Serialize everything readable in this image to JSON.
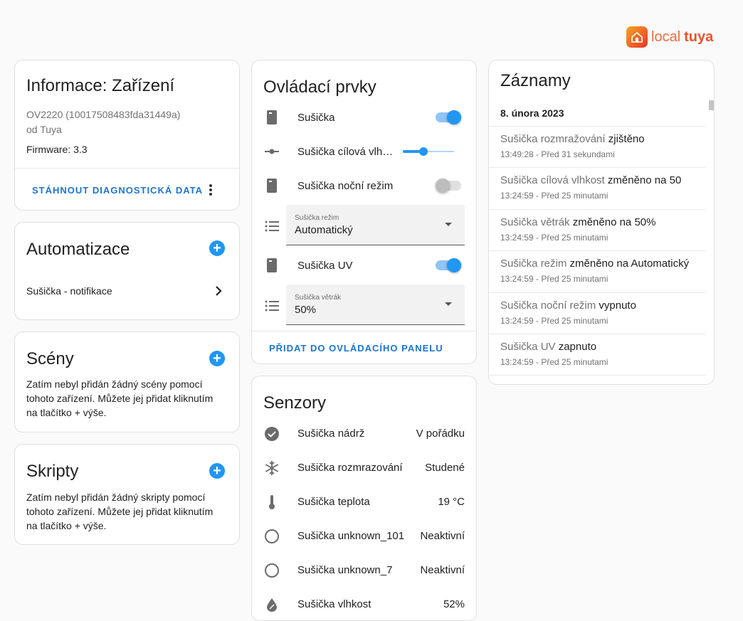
{
  "logo": {
    "word1": "local",
    "word2": "tuya",
    "color1": "#f26b3a",
    "color2": "#e8532a"
  },
  "info_card": {
    "title": "Informace: Zařízení",
    "model": "OV2220 (10017508483fda31449a)",
    "manufacturer": "od Tuya",
    "firmware": "Firmware: 3.3",
    "download_label": "STÁHNOUT DIAGNOSTICKÁ DATA"
  },
  "automation_card": {
    "title": "Automatizace",
    "item_label": "Sušička - notifikace"
  },
  "scenes_card": {
    "title": "Scény",
    "text": "Zatím nebyl přidán žádný scény pomocí tohoto zařízení. Můžete jej přidat kliknutím na tlačítko + výše."
  },
  "scripts_card": {
    "title": "Skripty",
    "text": "Zatím nebyl přidán žádný skripty pomocí tohoto zařízení. Můžete jej přidat kliknutím na tlačítko + výše."
  },
  "controls_card": {
    "title": "Ovládací prvky",
    "dryer_label": "Sušička",
    "dryer_on": true,
    "humidity_label": "Sušička cílová vlh…",
    "humidity_slider_fraction": 0.4,
    "night_label": "Sušička noční režim",
    "night_on": false,
    "mode_field_label": "Sušička režim",
    "mode_value": "Automatický",
    "uv_label": "Sušička UV",
    "uv_on": true,
    "fan_field_label": "Sušička větrák",
    "fan_value": "50%",
    "add_to_panel_label": "PŘIDAT DO OVLÁDACÍHO PANELU"
  },
  "sensors_card": {
    "title": "Senzory",
    "rows": [
      {
        "icon": "check-circle-icon",
        "label": "Sušička nádrž",
        "value": "V pořádku"
      },
      {
        "icon": "snowflake-icon",
        "label": "Sušička rozmrazování",
        "value": "Studené"
      },
      {
        "icon": "thermometer-icon",
        "label": "Sušička teplota",
        "value": "19 °C"
      },
      {
        "icon": "circle-outline-icon",
        "label": "Sušička unknown_101",
        "value": "Neaktivní"
      },
      {
        "icon": "circle-outline-icon",
        "label": "Sušička unknown_7",
        "value": "Neaktivní"
      },
      {
        "icon": "water-percent-icon",
        "label": "Sušička vlhkost",
        "value": "52%"
      }
    ]
  },
  "logbook_card": {
    "title": "Záznamy",
    "date": "8. února 2023",
    "entries": [
      {
        "entity": "Sušička rozmražování",
        "action": "zjištěno",
        "time": "13:49:28 - Před 31 sekundami"
      },
      {
        "entity": "Sušička cílová vlhkost",
        "action": "změněno na 50",
        "time": "13:24:59 - Před 25 minutami"
      },
      {
        "entity": "Sušička větrák",
        "action": "změněno na 50%",
        "time": "13:24:59 - Před 25 minutami"
      },
      {
        "entity": "Sušička režim",
        "action": "změněno na Automatický",
        "time": "13:24:59 - Před 25 minutami"
      },
      {
        "entity": "Sušička noční režim",
        "action": "vypnuto",
        "time": "13:24:59 - Před 25 minutami"
      },
      {
        "entity": "Sušička UV",
        "action": "zapnuto",
        "time": "13:24:59 - Před 25 minutami"
      }
    ]
  },
  "colors": {
    "accent": "#2196f3",
    "link": "#1976d2",
    "toggle_off": "#bdbdbd"
  }
}
